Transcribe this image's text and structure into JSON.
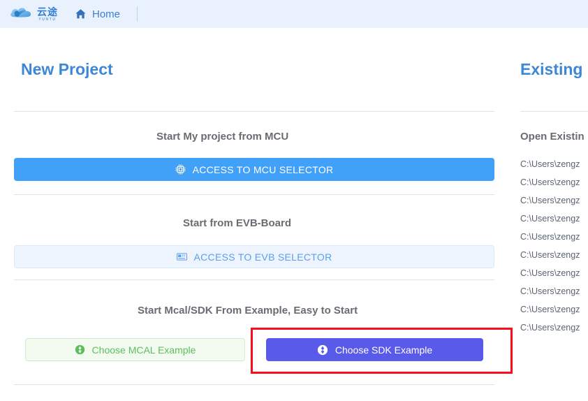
{
  "topbar": {
    "brand_cn": "云途",
    "brand_en": "YUNTU",
    "brand_icon": "cloud-logo-icon",
    "home_icon": "home-icon",
    "home_label": "Home"
  },
  "left_panel": {
    "title": "New Project",
    "sections": [
      {
        "heading": "Start My project from MCU",
        "button": {
          "label": "ACCESS TO MCU SELECTOR",
          "icon": "microchip-icon",
          "style": "primary-solid"
        }
      },
      {
        "heading": "Start from EVB-Board",
        "button": {
          "label": "ACCESS TO EVB SELECTOR",
          "icon": "circuit-board-icon",
          "style": "primary-soft"
        }
      },
      {
        "heading": "Start Mcal/SDK From Example, Easy to Start",
        "buttons": [
          {
            "label": "Choose MCAL Example",
            "icon": "package-cube-icon",
            "style": "success-outline"
          },
          {
            "label": "Choose SDK Example",
            "icon": "package-cube-icon",
            "style": "indigo-solid",
            "highlighted": true
          }
        ]
      }
    ]
  },
  "right_panel": {
    "title": "Existing",
    "heading": "Open Existin",
    "paths": [
      "C:\\Users\\zengz",
      "C:\\Users\\zengz",
      "C:\\Users\\zengz",
      "C:\\Users\\zengz",
      "C:\\Users\\zengz",
      "C:\\Users\\zengz",
      "C:\\Users\\zengz",
      "C:\\Users\\zengz",
      "C:\\Users\\zengz",
      "C:\\Users\\zengz"
    ]
  },
  "colors": {
    "header_bg": "#e9f1fd",
    "brand_blue": "#3d87d8",
    "mcu_button": "#41a0f8",
    "evb_button_text": "#5b9ef0",
    "mcal_green": "#5cbd5c",
    "sdk_indigo": "#5a5aea",
    "highlight_red": "#fc0d1b"
  }
}
